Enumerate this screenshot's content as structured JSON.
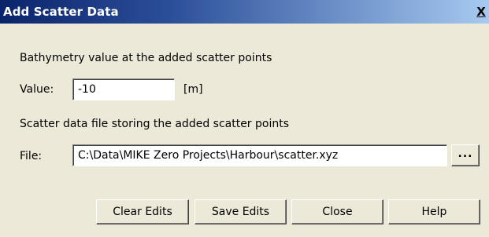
{
  "window": {
    "title": "Add Scatter Data",
    "close_glyph": "X"
  },
  "bathymetry": {
    "heading": "Bathymetry value at the added scatter points",
    "value_label": "Value:",
    "value": "-10",
    "unit": "[m]"
  },
  "scatter_file": {
    "heading": "Scatter data file storing the added scatter points",
    "file_label": "File:",
    "path": "C:\\Data\\MIKE Zero Projects\\Harbour\\scatter.xyz",
    "browse_label": "..."
  },
  "buttons": {
    "clear_edits": "Clear Edits",
    "save_edits": "Save Edits",
    "close": "Close",
    "help": "Help"
  },
  "colors": {
    "titlebar_start": "#0a246a",
    "titlebar_end": "#a6caf0",
    "dialog_background": "#ece9d8"
  }
}
